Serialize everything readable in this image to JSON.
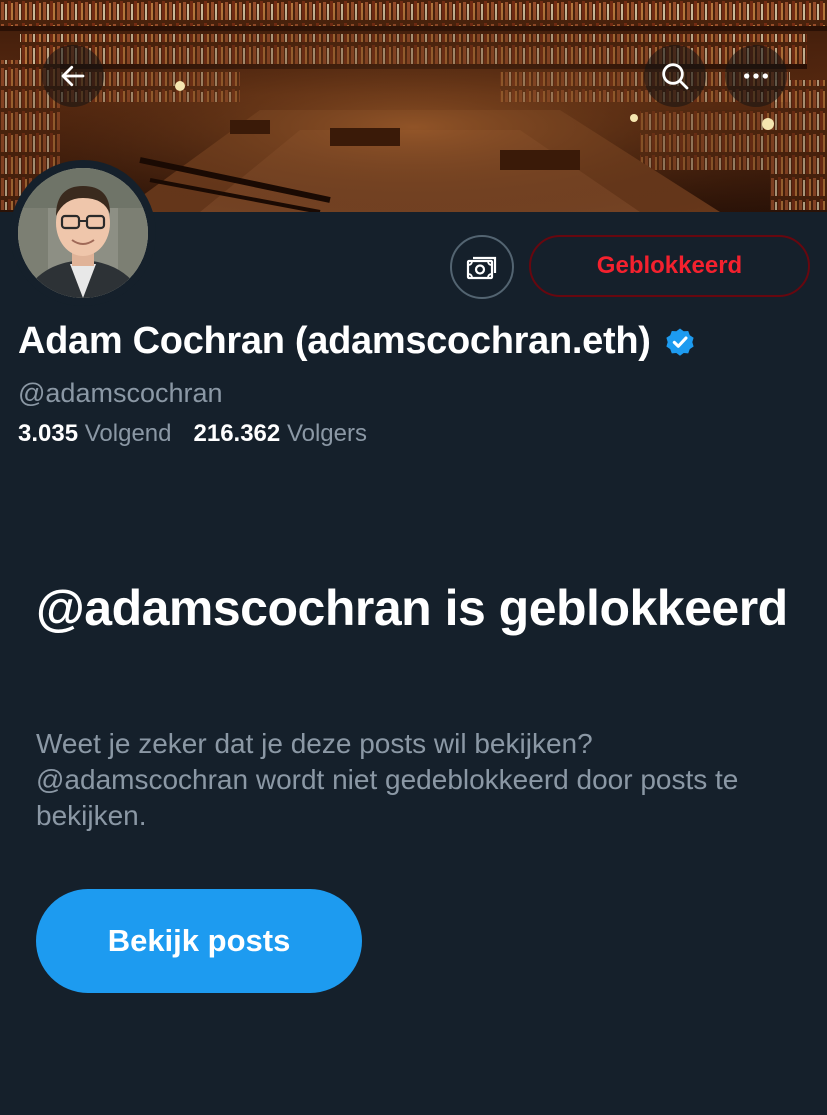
{
  "header": {
    "back_icon": "arrow-left-icon",
    "search_icon": "search-icon",
    "more_icon": "more-horizontal-icon"
  },
  "profile": {
    "display_name": "Adam Cochran (adamscochran.eth)",
    "handle": "@adamscochran",
    "verified": true,
    "following_count": "3.035",
    "following_label": "Volgend",
    "followers_count": "216.362",
    "followers_label": "Volgers"
  },
  "actions": {
    "tips_icon": "money-tips-icon",
    "blocked_label": "Geblokkeerd"
  },
  "block_notice": {
    "title": "@adamscochran is geblokkeerd",
    "description": "Weet je zeker dat je deze posts wil bekijken? @adamscochran wordt niet gedeblokkeerd door posts te bekijken.",
    "button_label": "Bekijk posts"
  },
  "colors": {
    "background": "#15202b",
    "accent": "#1d9bf0",
    "danger": "#f4212e",
    "secondary_text": "#8b98a5"
  }
}
